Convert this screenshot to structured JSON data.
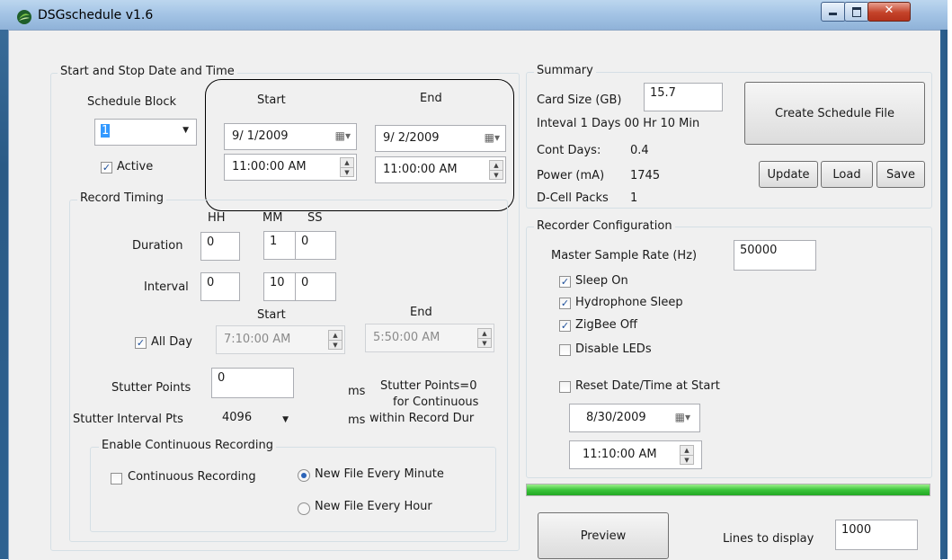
{
  "window": {
    "title": "DSGschedule v1.6"
  },
  "start_stop": {
    "group_title": "Start and Stop Date and Time",
    "schedule_block_label": "Schedule Block",
    "schedule_block_value": "1",
    "active_label": "Active",
    "active_checked": true,
    "start_label": "Start",
    "end_label": "End",
    "start_date": "9/ 1/2009",
    "start_time": "11:00:00 AM",
    "end_date": "9/ 2/2009",
    "end_time": "11:00:00 AM"
  },
  "record_timing": {
    "group_title": "Record Timing",
    "hh_label": "HH",
    "mm_label": "MM",
    "ss_label": "SS",
    "duration_label": "Duration",
    "duration": {
      "hh": "0",
      "mm": "1",
      "ss": "0"
    },
    "interval_label": "Interval",
    "interval": {
      "hh": "0",
      "mm": "10",
      "ss": "0"
    },
    "all_day_label": "All Day",
    "all_day_checked": true,
    "day_start_label": "Start",
    "day_end_label": "End",
    "day_start_time": "7:10:00 AM",
    "day_end_time": "5:50:00 AM",
    "stutter_points_label": "Stutter Points",
    "stutter_points_value": "0",
    "stutter_interval_label": "Stutter Interval Pts",
    "stutter_interval_value": "4096",
    "ms_unit_1": "ms",
    "ms_unit_2": "ms",
    "stutter_note_line1": "Stutter Points=0",
    "stutter_note_line2": "for Continuous",
    "stutter_note_line3": "within Record Dur"
  },
  "continuous": {
    "group_title": "Enable Continuous Recording",
    "continuous_label": "Continuous Recording",
    "continuous_checked": false,
    "file_minute_label": "New File Every Minute",
    "file_hour_label": "New File Every Hour",
    "selected": "minute"
  },
  "summary": {
    "group_title": "Summary",
    "card_size_label": "Card Size (GB)",
    "card_size_value": "15.7",
    "interval_text": "Inteval  1 Days 00 Hr 10 Min",
    "cont_days_label": "Cont Days:",
    "cont_days_value": "0.4",
    "power_label": "Power (mA)",
    "power_value": "1745",
    "dcell_label": "D-Cell Packs",
    "dcell_value": "1",
    "create_button": "Create Schedule File",
    "update_button": "Update",
    "load_button": "Load",
    "save_button": "Save"
  },
  "recorder": {
    "group_title": "Recorder Configuration",
    "sample_rate_label": "Master Sample Rate (Hz)",
    "sample_rate_value": "50000",
    "sleep_on_label": "Sleep On",
    "sleep_on_checked": true,
    "hydrophone_sleep_label": "Hydrophone Sleep",
    "hydrophone_sleep_checked": true,
    "zigbee_off_label": "ZigBee Off",
    "zigbee_off_checked": true,
    "disable_leds_label": "Disable LEDs",
    "disable_leds_checked": false,
    "reset_label": "Reset Date/Time at Start",
    "reset_checked": false,
    "reset_date": "8/30/2009",
    "reset_time": "11:10:00 AM"
  },
  "progress": {
    "value_percent": 100,
    "color": "#2ecc40"
  },
  "bottom": {
    "preview_button": "Preview",
    "lines_label": "Lines to display",
    "lines_value": "1000"
  },
  "colors": {
    "highlight_outline": "#000000",
    "selection": "#3399ff"
  }
}
